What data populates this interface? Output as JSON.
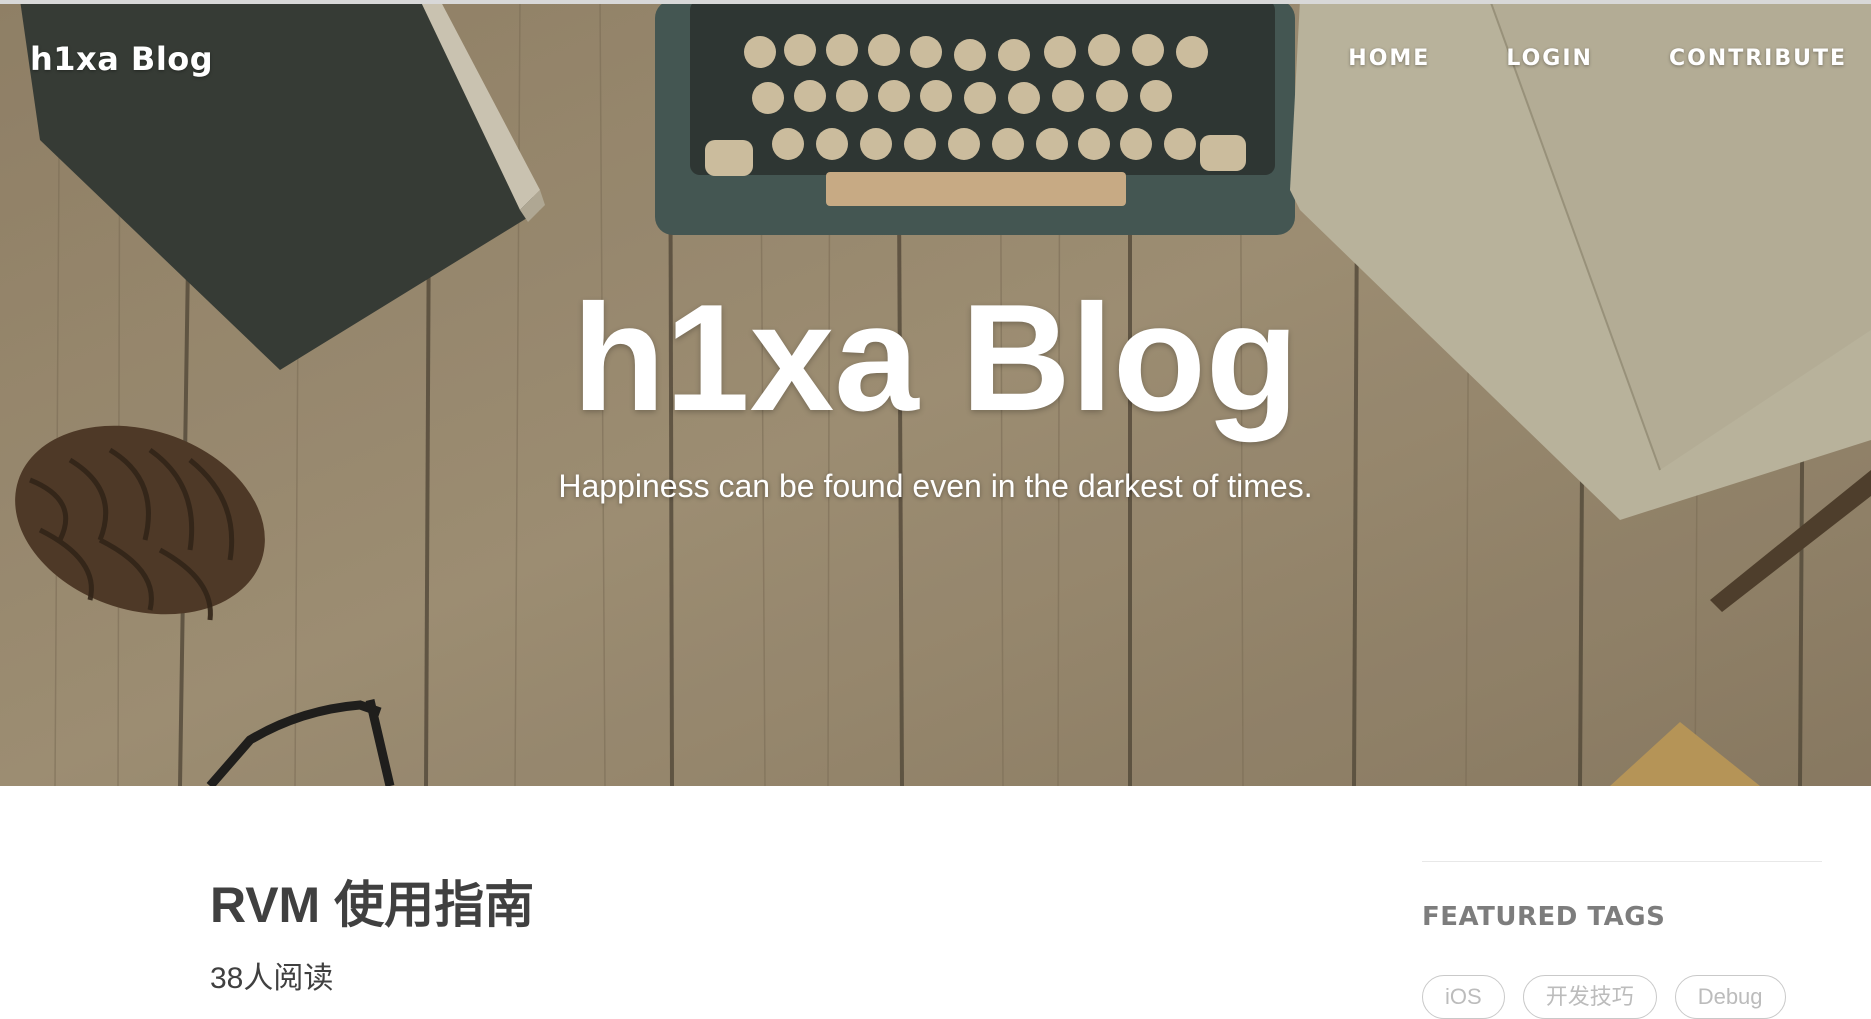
{
  "brand": {
    "title": "h1xa Blog"
  },
  "nav": {
    "items": [
      "HOME",
      "LOGIN",
      "CONTRIBUTE"
    ]
  },
  "hero": {
    "title": "h1xa Blog",
    "subtitle": "Happiness can be found even in the darkest of times.",
    "background_image": "wooden desk with typewriter, books, pinecone, glasses and notebook"
  },
  "post": {
    "title": "RVM 使用指南",
    "meta": "38人阅读"
  },
  "sidebar": {
    "featured_tags_title": "FEATURED TAGS",
    "tags": [
      "iOS",
      "开发技巧",
      "Debug"
    ]
  },
  "colors": {
    "hero_overlay": "#8a7b62",
    "post_text": "#404040",
    "sidebar_heading": "#7d7d7d",
    "tag_border": "#c9c9c9"
  }
}
